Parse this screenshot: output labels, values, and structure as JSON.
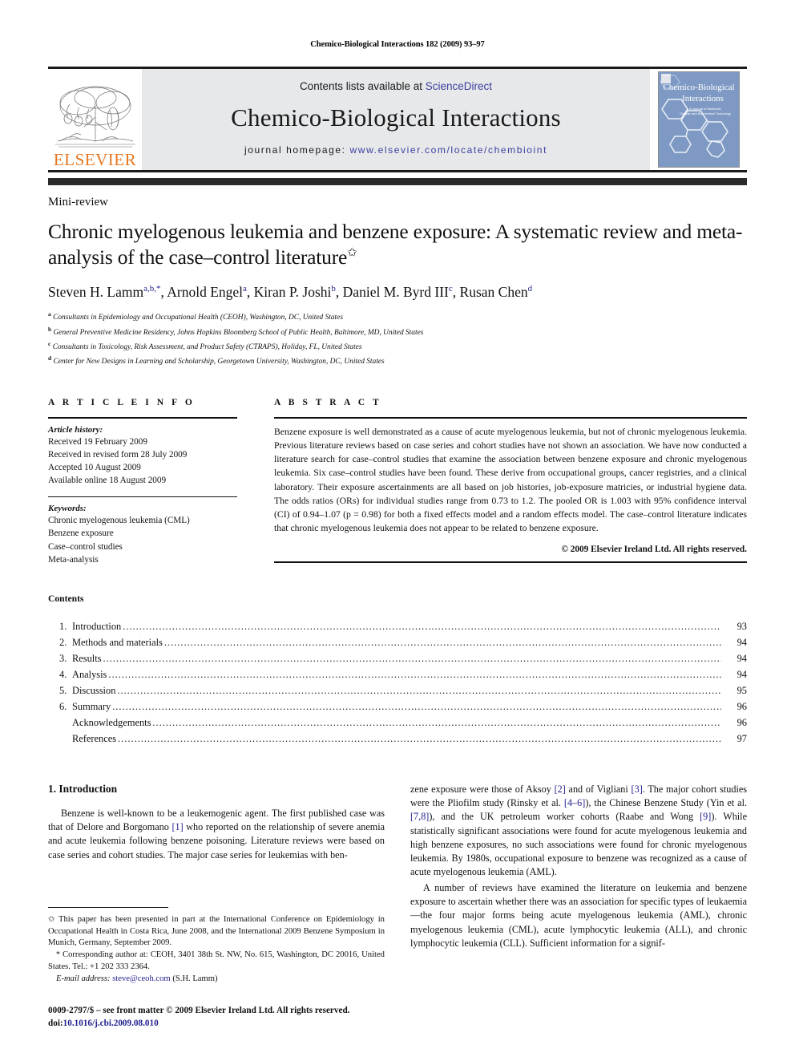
{
  "running_head": "Chemico-Biological Interactions 182 (2009) 93–97",
  "journal_header": {
    "contents_prefix": "Contents lists available at ",
    "sciencedirect": "ScienceDirect",
    "journal_title": "Chemico-Biological Interactions",
    "homepage_label": "journal homepage:",
    "homepage_url": "www.elsevier.com/locate/chembioint",
    "publisher_logo_text": "ELSEVIER",
    "cover_title_line1": "Chemico-Biological",
    "cover_title_line2": "Interactions",
    "cover_sub1": "A Journal of Molecular",
    "cover_sub2": "Cellular and Biochemical Toxicology",
    "link_color": "#3b3fa0",
    "band_color": "#e7e8ea",
    "elsevier_orange": "#E87722"
  },
  "article": {
    "type": "Mini-review",
    "title": "Chronic myelogenous leukemia and benzene exposure: A systematic review and meta-analysis of the case–control literature",
    "title_marker": "✩",
    "authors_html": "Steven H. Lamm<sup>a,b,</sup><sup>*</sup>, Arnold Engel<sup>a</sup>, Kiran P. Joshi<sup>b</sup>, Daniel M. Byrd III<sup>c</sup>, Rusan Chen<sup>d</sup>",
    "affiliations": [
      {
        "mark": "a",
        "text": "Consultants in Epidemiology and Occupational Health (CEOH), Washington, DC, United States"
      },
      {
        "mark": "b",
        "text": "General Preventive Medicine Residency, Johns Hopkins Bloomberg School of Public Health, Baltimore, MD, United States"
      },
      {
        "mark": "c",
        "text": "Consultants in Toxicology, Risk Assessment, and Product Safety (CTRAPS), Holiday, FL, United States"
      },
      {
        "mark": "d",
        "text": "Center for New Designs in Learning and Scholarship, Georgetown University, Washington, DC, United States"
      }
    ]
  },
  "article_info": {
    "heading": "A R T I C L E    I N F O",
    "history_label": "Article history:",
    "history": [
      "Received 19 February 2009",
      "Received in revised form 28 July 2009",
      "Accepted 10 August 2009",
      "Available online 18 August 2009"
    ],
    "keywords_label": "Keywords:",
    "keywords": [
      "Chronic myelogenous leukemia (CML)",
      "Benzene exposure",
      "Case–control studies",
      "Meta-analysis"
    ]
  },
  "abstract": {
    "heading": "A B S T R A C T",
    "text": "Benzene exposure is well demonstrated as a cause of acute myelogenous leukemia, but not of chronic myelogenous leukemia. Previous literature reviews based on case series and cohort studies have not shown an association. We have now conducted a literature search for case–control studies that examine the association between benzene exposure and chronic myelogenous leukemia. Six case–control studies have been found. These derive from occupational groups, cancer registries, and a clinical laboratory. Their exposure ascertainments are all based on job histories, job-exposure matricies, or industrial hygiene data. The odds ratios (ORs) for individual studies range from 0.73 to 1.2. The pooled OR is 1.003 with 95% confidence interval (CI) of 0.94–1.07 (p = 0.98) for both a fixed effects model and a random effects model. The case–control literature indicates that chronic myelogenous leukemia does not appear to be related to benzene exposure.",
    "copyright": "© 2009 Elsevier Ireland Ltd. All rights reserved."
  },
  "contents": {
    "title": "Contents",
    "entries": [
      {
        "num": "1.",
        "label": "Introduction",
        "page": "93",
        "sub": false
      },
      {
        "num": "2.",
        "label": "Methods and materials",
        "page": "94",
        "sub": false
      },
      {
        "num": "3.",
        "label": "Results",
        "page": "94",
        "sub": false
      },
      {
        "num": "4.",
        "label": "Analysis",
        "page": "94",
        "sub": false
      },
      {
        "num": "5.",
        "label": "Discussion",
        "page": "95",
        "sub": false
      },
      {
        "num": "6.",
        "label": "Summary",
        "page": "96",
        "sub": false
      },
      {
        "num": "",
        "label": "Acknowledgements",
        "page": "96",
        "sub": true
      },
      {
        "num": "",
        "label": "References",
        "page": "97",
        "sub": true
      }
    ],
    "dot_leader": "................................................................................................................................................................................................................................."
  },
  "body": {
    "section_number_title": "1.  Introduction",
    "left_para_1_html": "Benzene is well-known to be a leukemogenic agent. The first published case was that of Delore and Borgomano <span class=\"ref\">[1]</span> who reported on the relationship of severe anemia and acute leukemia following benzene poisoning. Literature reviews were based on case series and cohort studies. The major case series for leukemias with ben-",
    "right_para_1_html": "zene exposure were those of Aksoy <span class=\"ref\">[2]</span> and of Vigliani <span class=\"ref\">[3]</span>. The major cohort studies were the Pliofilm study (Rinsky et al. <span class=\"ref\">[4–6]</span>), the Chinese Benzene Study (Yin et al. <span class=\"ref\">[7,8]</span>), and the UK petroleum worker cohorts (Raabe and Wong <span class=\"ref\">[9]</span>). While statistically significant associations were found for acute myelogenous leukemia and high benzene exposures, no such associations were found for chronic myelogenous leukemia. By 1980s, occupational exposure to benzene was recognized as a cause of acute myelogenous leukemia (AML).",
    "right_para_2_html": "A number of reviews have examined the literature on leukemia and benzene exposure to ascertain whether there was an association for specific types of leukaemia—the four major forms being acute myelogenous leukemia (AML), chronic myelogenous leukemia (CML), acute lymphocytic leukemia (ALL), and chronic lymphocytic leukemia (CLL). Sufficient information for a signif-"
  },
  "footnotes": {
    "star_mark": "✩",
    "star_text": "This paper has been presented in part at the International Conference on Epidemiology in Occupational Health in Costa Rica, June 2008, and the International 2009 Benzene Symposium in Munich, Germany, September 2009.",
    "corresponding_mark": "*",
    "corresponding_text": "Corresponding author at: CEOH, 3401 38th St. NW, No. 615, Washington, DC 20016, United States. Tel.: +1 202 333 2364.",
    "email_label": "E-mail address:",
    "email": "steve@ceoh.com",
    "email_suffix": "(S.H. Lamm)"
  },
  "imprint": {
    "line1": "0009-2797/$ – see front matter © 2009 Elsevier Ireland Ltd. All rights reserved.",
    "doi_label": "doi:",
    "doi": "10.1016/j.cbi.2009.08.010"
  }
}
